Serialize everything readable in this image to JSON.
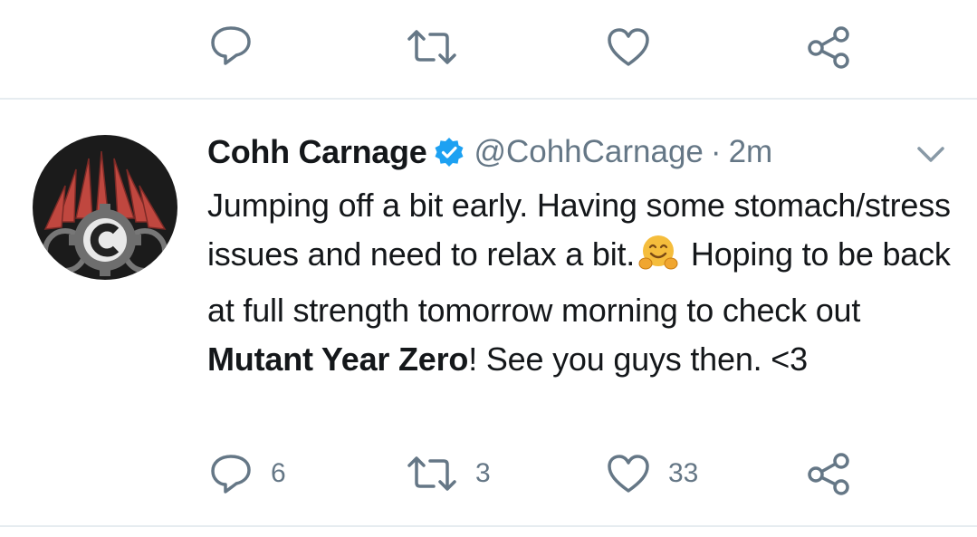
{
  "previous_tweet_actions": {
    "reply_icon": "reply-icon",
    "retweet_icon": "retweet-icon",
    "like_icon": "heart-icon",
    "share_icon": "share-icon"
  },
  "tweet": {
    "author_name": "Cohh Carnage",
    "verified": true,
    "handle": "@CohhCarnage",
    "separator": "·",
    "time": "2m",
    "text_part1": "Jumping off a bit early. Having some stomach/stress issues and need to relax a bit.",
    "emoji": "hugging-face-emoji",
    "text_part2": " Hoping to be back at full strength tomorrow morning to check out ",
    "text_bold": "Mutant Year Zero",
    "text_part3": "! See you guys then. <3",
    "actions": {
      "replies": "6",
      "retweets": "3",
      "likes": "33"
    }
  },
  "colors": {
    "text": "#14171a",
    "secondary": "#657786",
    "verified": "#1da1f2",
    "divider": "#e6ecf0"
  }
}
